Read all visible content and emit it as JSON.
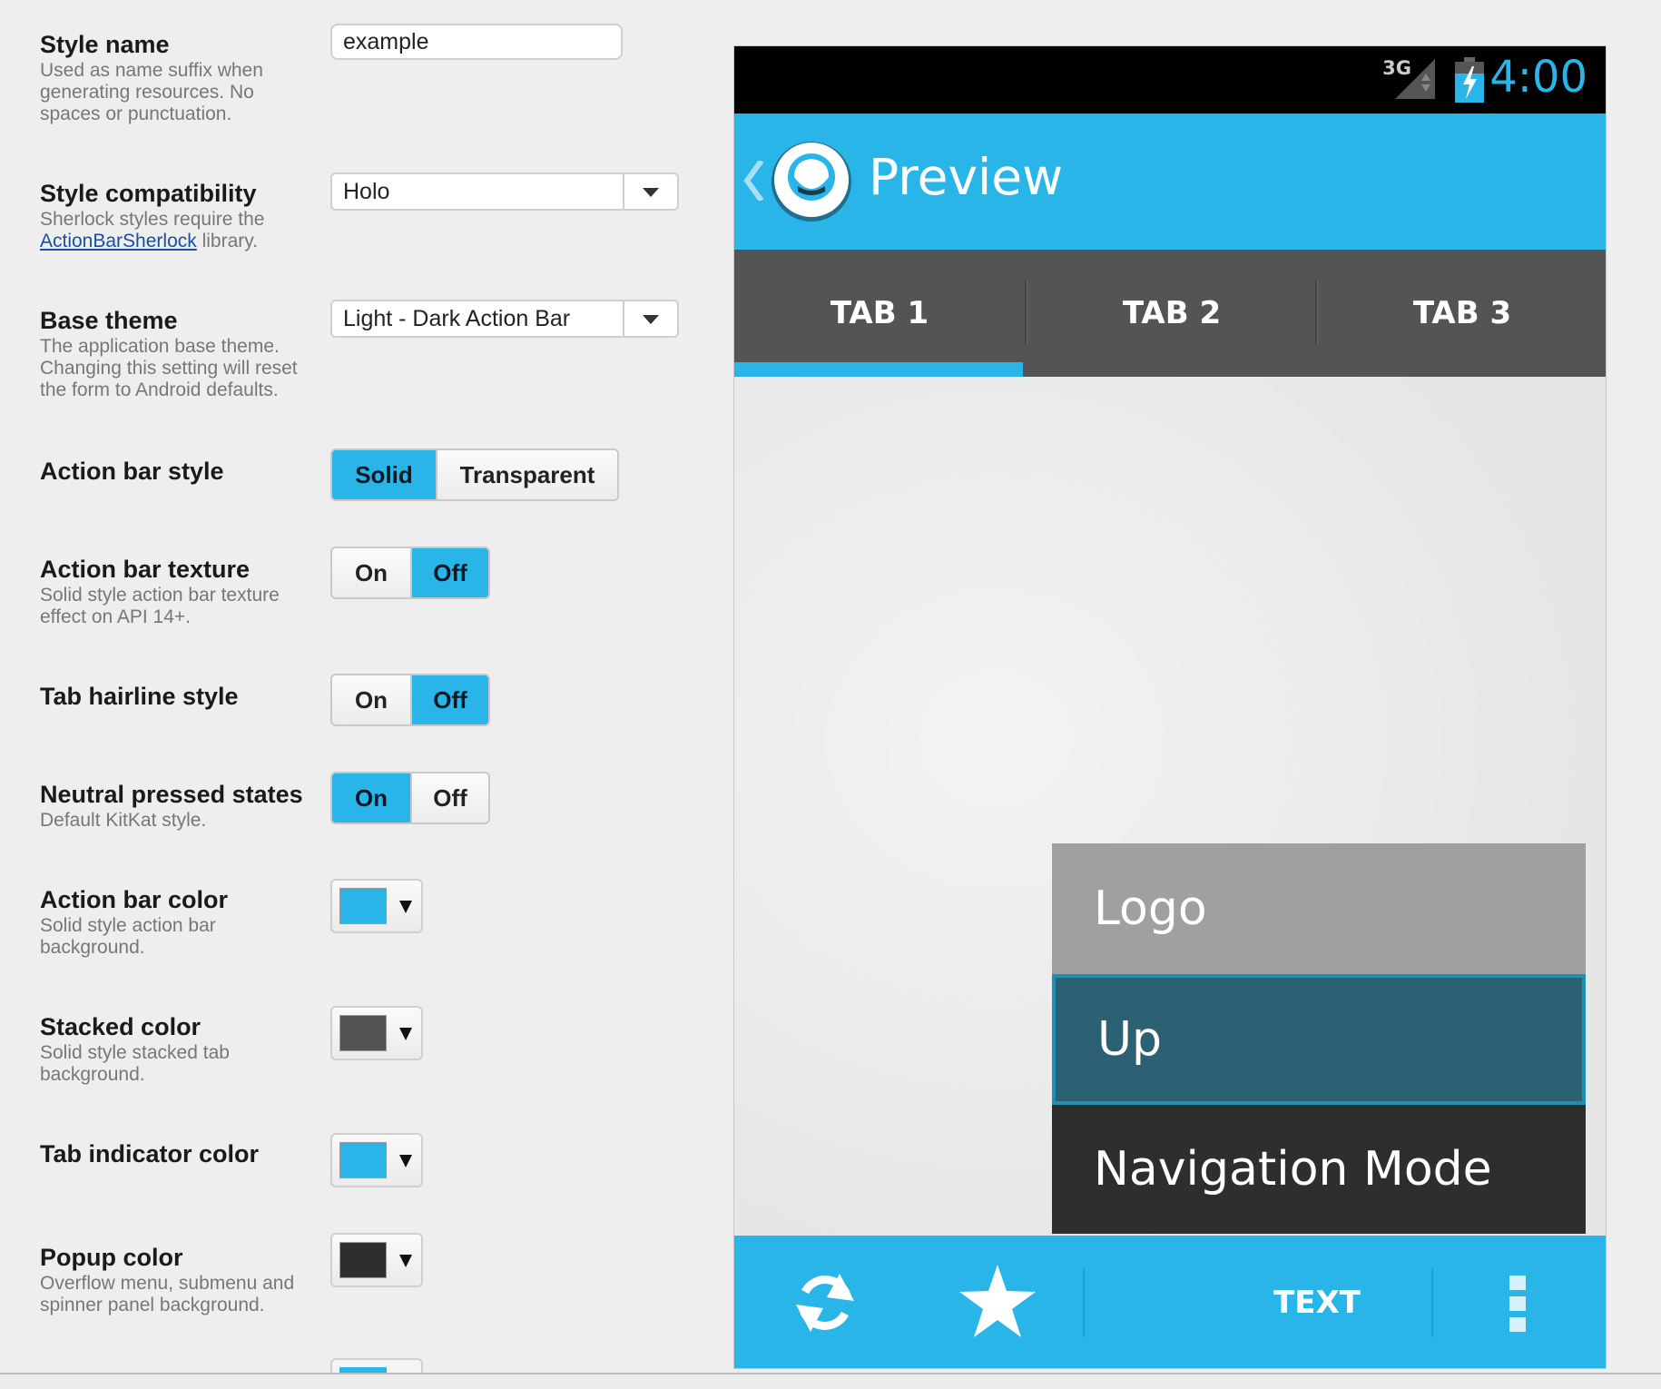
{
  "form": {
    "style_name": {
      "title": "Style name",
      "desc": "Used as name suffix when generating resources. No spaces or punctuation.",
      "value": "example"
    },
    "style_compat": {
      "title": "Style compatibility",
      "desc_pre": "Sherlock styles require the ",
      "desc_link": "ActionBarSherlock",
      "desc_post": " library.",
      "value": "Holo"
    },
    "base_theme": {
      "title": "Base theme",
      "desc": "The application base theme. Changing this setting will reset the form to Android defaults.",
      "value": "Light - Dark Action Bar"
    },
    "action_bar_style": {
      "title": "Action bar style",
      "options": [
        "Solid",
        "Transparent"
      ],
      "selected": "Solid"
    },
    "action_bar_texture": {
      "title": "Action bar texture",
      "desc": "Solid style action bar texture effect on API 14+.",
      "options": [
        "On",
        "Off"
      ],
      "selected": "Off"
    },
    "tab_hairline": {
      "title": "Tab hairline style",
      "options": [
        "On",
        "Off"
      ],
      "selected": "Off"
    },
    "neutral_pressed": {
      "title": "Neutral pressed states",
      "desc": "Default KitKat style.",
      "options": [
        "On",
        "Off"
      ],
      "selected": "On"
    },
    "action_bar_color": {
      "title": "Action bar color",
      "desc": "Solid style action bar background.",
      "color": "#29b5e8"
    },
    "stacked_color": {
      "title": "Stacked color",
      "desc": "Solid style stacked tab background.",
      "color": "#545454"
    },
    "tab_indicator_color": {
      "title": "Tab indicator color",
      "color": "#29b5e8"
    },
    "popup_color": {
      "title": "Popup color",
      "desc": "Overflow menu, submenu and spinner panel background.",
      "color": "#2e2e2e"
    }
  },
  "preview": {
    "status": {
      "network": "3G",
      "time": "4:00"
    },
    "title": "Preview",
    "tabs": [
      "TAB 1",
      "TAB 2",
      "TAB 3"
    ],
    "popup_items": [
      "Logo",
      "Up",
      "Navigation Mode"
    ],
    "split_text": "TEXT",
    "icons": [
      "refresh-icon",
      "star-icon",
      "overflow-icon",
      "up-caret-icon",
      "logo-icon",
      "battery-icon",
      "signal-icon"
    ]
  },
  "colors": {
    "accent": "#29b5e8",
    "stacked": "#545454",
    "popup": "#2e2e2e"
  }
}
